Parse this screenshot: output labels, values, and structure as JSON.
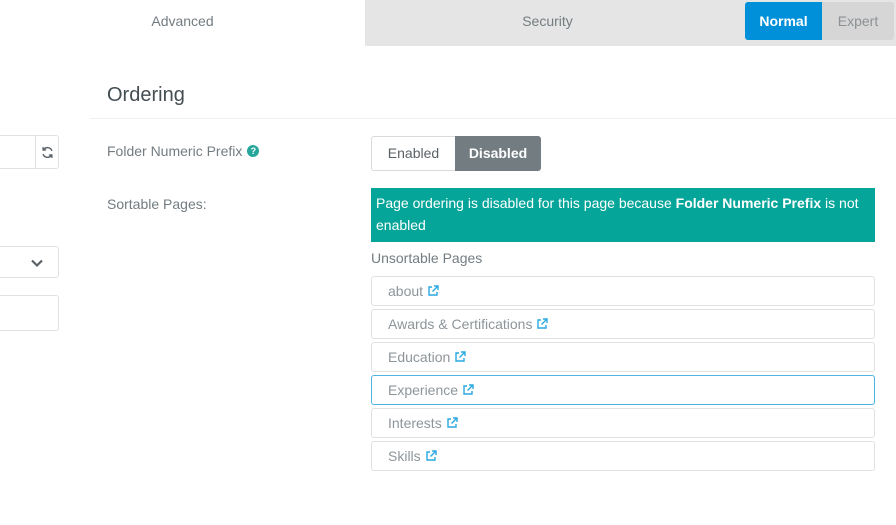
{
  "tabs": {
    "advanced": "Advanced",
    "security": "Security"
  },
  "mode": {
    "normal": "Normal",
    "expert": "Expert"
  },
  "section": {
    "title": "Ordering"
  },
  "folder_prefix": {
    "label": "Folder Numeric Prefix",
    "help_icon": "?",
    "options": [
      "Enabled",
      "Disabled"
    ],
    "selected": "Disabled"
  },
  "sortable": {
    "label": "Sortable Pages:",
    "notice_prefix": "Page ordering is disabled for this page because ",
    "notice_bold": "Folder Numeric Prefix",
    "notice_suffix": " is not enabled",
    "unsortable_title": "Unsortable Pages",
    "pages": [
      "about",
      "Awards & Certifications",
      "Education",
      "Experience",
      "Interests",
      "Skills"
    ]
  },
  "colors": {
    "accent": "#0090d9",
    "notice": "#06a599",
    "active_border": "#4fb3e6"
  }
}
